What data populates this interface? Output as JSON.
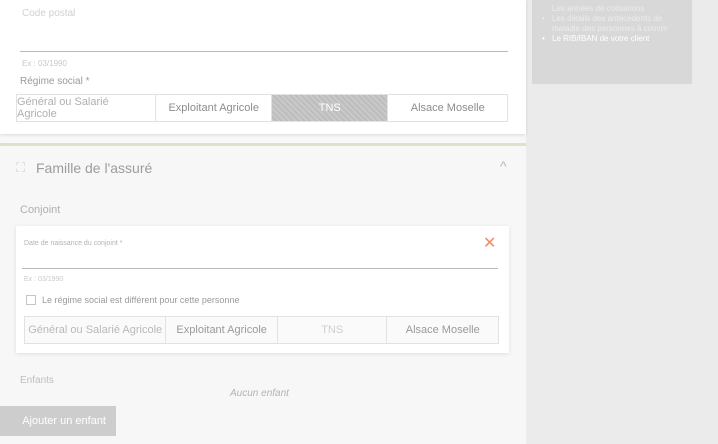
{
  "top_card": {
    "ghost_label": "Code postal",
    "ghost_value": "",
    "hint": "Ex : 03/1990",
    "regime_label": "Régime social *",
    "options": [
      "Général ou Salarié Agricole",
      "Exploitant Agricole",
      "TNS",
      "Alsace Moselle"
    ],
    "selected": "TNS"
  },
  "famille": {
    "icon": "family-icon",
    "title": "Famille de l'assuré",
    "chevron": "^",
    "conjoint_label": "Conjoint",
    "birth_label": "Date de naissance du conjoint *",
    "close_symbol": "✕",
    "birth_hint": "Ex : 03/1990",
    "checkbox_label": "Le régime social est différent pour cette personne",
    "options": [
      "Général ou Salarié Agricole",
      "Exploitant Agricole",
      "TNS",
      "Alsace Moselle"
    ],
    "enfants_label": "Enfants",
    "no_children": "Aucun enfant",
    "add_child_button": "Ajouter un enfant"
  },
  "side_panel": {
    "items": [
      "Les années de cotisations",
      "Les détails des antécédents de",
      "maladie des personnes à couvrir",
      "Le RIB/IBAN de votre client"
    ]
  },
  "colors": {
    "accent": "#dbe3c8",
    "close": "#f08a6a",
    "selected": "#c6c6c6"
  }
}
